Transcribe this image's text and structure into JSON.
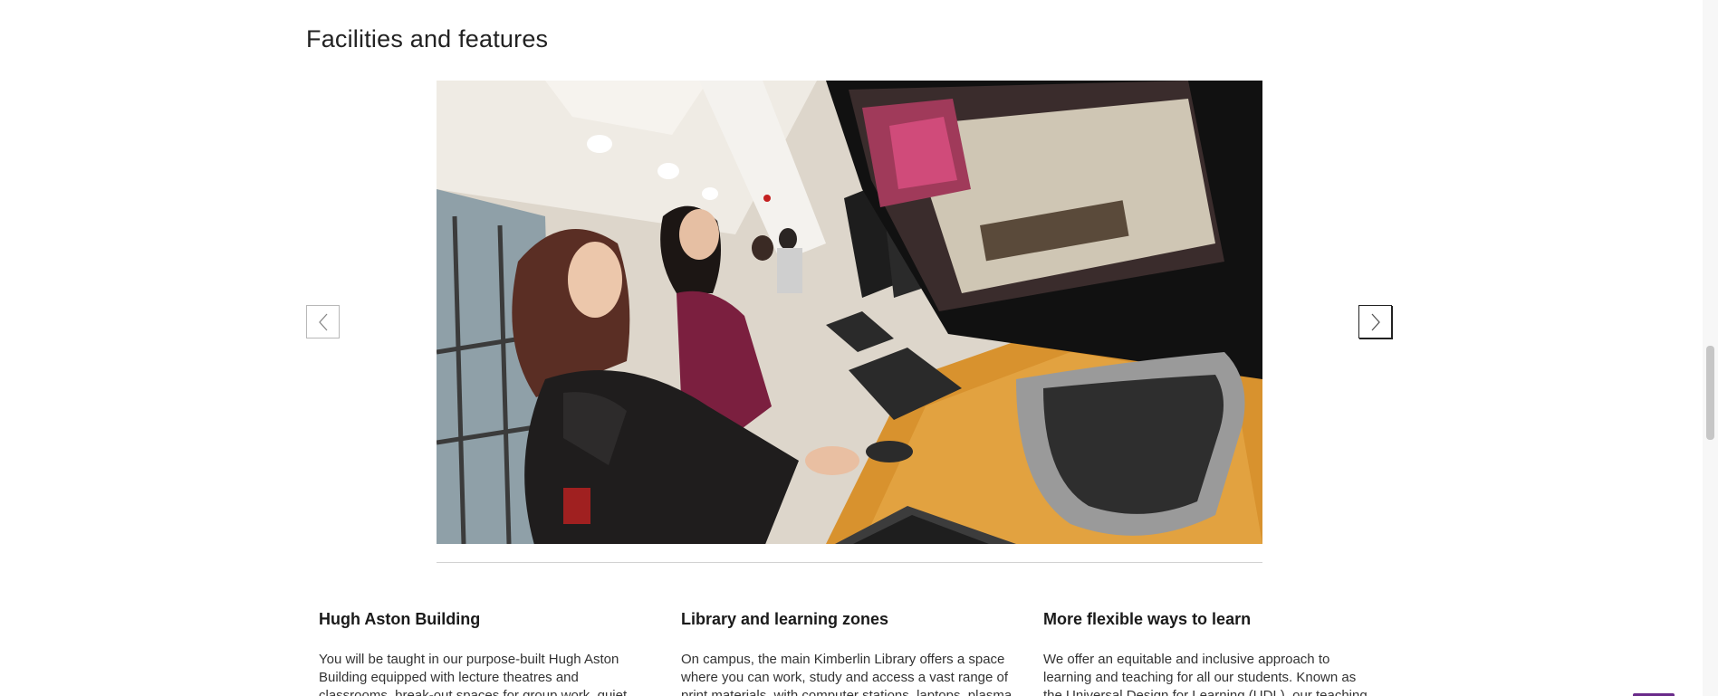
{
  "section": {
    "title": "Facilities and features"
  },
  "carousel": {
    "image_alt": "Students working at computer stations in a library",
    "prev_icon": "chevron-left-icon",
    "next_icon": "chevron-right-icon"
  },
  "features": [
    {
      "title": "Hugh Aston Building",
      "text": "You will be taught in our purpose-built Hugh Aston Building equipped with lecture theatres and classrooms, break-out spaces for group work, quiet"
    },
    {
      "title": "Library and learning zones",
      "text": "On campus, the main Kimberlin Library offers a space where you can work, study and access a vast range of print materials, with computer stations, laptops, plasma"
    },
    {
      "title": "More flexible ways to learn",
      "text": "We offer an equitable and inclusive approach to learning and teaching for all our students. Known as the Universal Design for Learning (UDL), our teaching"
    }
  ],
  "colors": {
    "accent": "#6a2b8a",
    "divider": "#d2d2d2"
  }
}
